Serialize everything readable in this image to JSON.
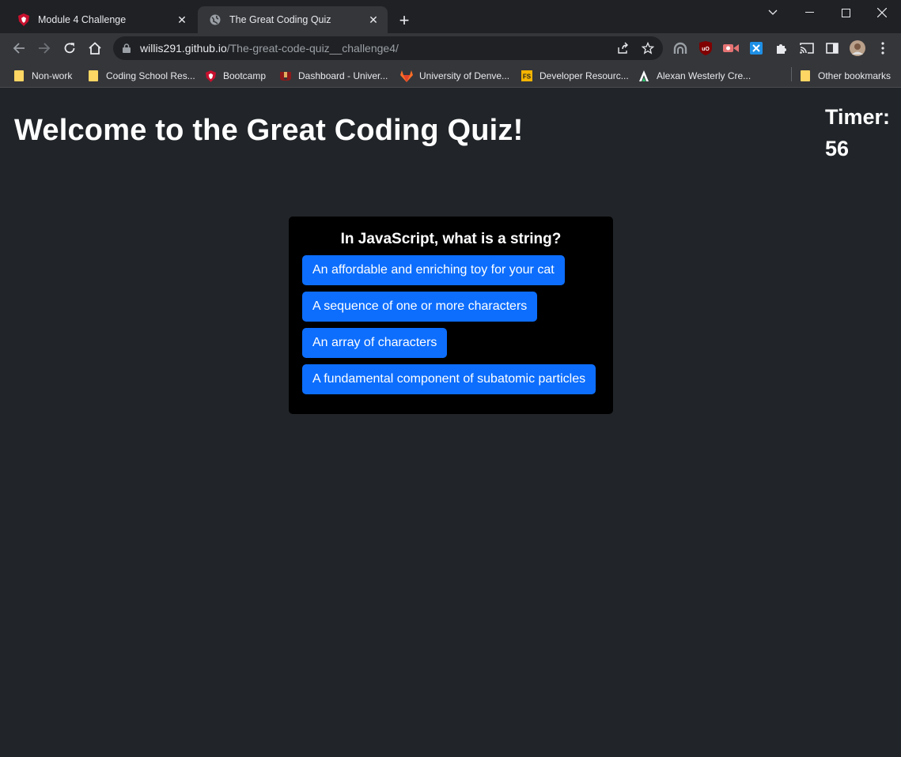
{
  "tabs": [
    {
      "title": "Module 4 Challenge",
      "active": false
    },
    {
      "title": "The Great Coding Quiz",
      "active": true
    }
  ],
  "toolbar": {
    "url_host": "willis291.github.io",
    "url_path": "/The-great-code-quiz__challenge4/"
  },
  "bookmarks": [
    {
      "label": "Non-work",
      "icon": "folder-icon"
    },
    {
      "label": "Coding School Res...",
      "icon": "folder-icon"
    },
    {
      "label": "Bootcamp",
      "icon": "shield-icon"
    },
    {
      "label": "Dashboard - Univer...",
      "icon": "du-logo-icon"
    },
    {
      "label": "University of Denve...",
      "icon": "gitlab-icon"
    },
    {
      "label": "Developer Resourc...",
      "icon": "fs-icon"
    },
    {
      "label": "Alexan Westerly Cre...",
      "icon": "a-logo-icon"
    },
    {
      "label": "Other bookmarks",
      "icon": "folder-icon"
    }
  ],
  "page": {
    "title": "Welcome to the Great Coding Quiz!",
    "timer_label": "Timer:",
    "timer_value": "56",
    "question": "In JavaScript, what is a string?",
    "answers": [
      "An affordable and enriching toy for your cat",
      "A sequence of one or more characters",
      "An array of characters",
      "A fundamental component of subatomic particles"
    ]
  },
  "colors": {
    "page_bg": "#212529",
    "card_bg": "#000000",
    "button_bg": "#0d6efd"
  }
}
